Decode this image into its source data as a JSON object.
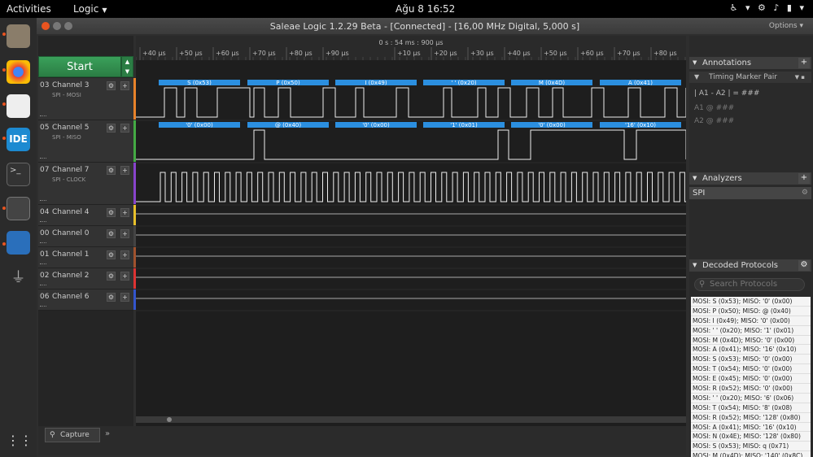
{
  "topbar": {
    "activities": "Activities",
    "app": "Logic",
    "clock": "Ağu 8  16:52"
  },
  "window": {
    "title": "Saleae Logic 1.2.29 Beta - [Connected] - [16,00 MHz Digital, 5,000 s]",
    "options": "Options ▾"
  },
  "start": {
    "label": "Start"
  },
  "timeline": {
    "center": "0 s : 54 ms : 900 µs",
    "ticks": [
      "+40 µs",
      "+50 µs",
      "+60 µs",
      "+70 µs",
      "+80 µs",
      "+90 µs",
      "+10 µs",
      "+20 µs",
      "+30 µs",
      "+40 µs",
      "+50 µs",
      "+60 µs",
      "+70 µs",
      "+80 µs"
    ]
  },
  "channels": [
    {
      "num": "03",
      "name": "Channel 3",
      "sub": "SPI - MOSI",
      "color": "#e8822a"
    },
    {
      "num": "05",
      "name": "Channel 5",
      "sub": "SPI - MISO",
      "color": "#44aa44"
    },
    {
      "num": "07",
      "name": "Channel 7",
      "sub": "SPI - CLOCK",
      "color": "#8844cc"
    },
    {
      "num": "04",
      "name": "Channel 4",
      "sub": "",
      "color": "#e8c02a"
    },
    {
      "num": "00",
      "name": "Channel 0",
      "sub": "",
      "color": "#444444"
    },
    {
      "num": "01",
      "name": "Channel 1",
      "sub": "",
      "color": "#a0522d"
    },
    {
      "num": "02",
      "name": "Channel 2",
      "sub": "",
      "color": "#dd3333"
    },
    {
      "num": "06",
      "name": "Channel 6",
      "sub": "",
      "color": "#3355cc"
    }
  ],
  "mosi_labels": [
    "S (0x53)",
    "P (0x50)",
    "I (0x49)",
    "' ' (0x20)",
    "M (0x4D)",
    "A (0x41)"
  ],
  "miso_labels": [
    "'0' (0x00)",
    "@ (0x40)",
    "'0' (0x00)",
    "'1' (0x01)",
    "'0' (0x00)",
    "'16' (0x10)"
  ],
  "bottom": {
    "capture": "Capture"
  },
  "annotations": {
    "header": "Annotations",
    "marker": "Timing Marker Pair",
    "rows": [
      "| A1 - A2 | = ###",
      "A1  @  ###",
      "A2  @  ###"
    ]
  },
  "analyzers": {
    "header": "Analyzers",
    "item": "SPI"
  },
  "decoded": {
    "header": "Decoded Protocols",
    "search_placeholder": "Search Protocols",
    "items": [
      "MOSI: S (0x53);  MISO: '0' (0x00)",
      "MOSI: P (0x50);  MISO: @ (0x40)",
      "MOSI: I (0x49);  MISO: '0' (0x00)",
      "MOSI: ' ' (0x20);  MISO: '1' (0x01)",
      "MOSI: M (0x4D);  MISO: '0' (0x00)",
      "MOSI: A (0x41);  MISO: '16' (0x10)",
      "MOSI: S (0x53);  MISO: '0' (0x00)",
      "MOSI: T (0x54);  MISO: '0' (0x00)",
      "MOSI: E (0x45);  MISO: '0' (0x00)",
      "MOSI: R (0x52);  MISO: '0' (0x00)",
      "MOSI: ' ' (0x20);  MISO: '6' (0x06)",
      "MOSI: T (0x54);  MISO: '8' (0x08)",
      "MOSI: R (0x52);  MISO: '128' (0x80)",
      "MOSI: A (0x41);  MISO: '16' (0x10)",
      "MOSI: N (0x4E);  MISO: '128' (0x80)",
      "MOSI: S (0x53);  MISO: q (0x71)",
      "MOSI: M (0x4D);  MISO: '140' (0x8C)"
    ]
  }
}
